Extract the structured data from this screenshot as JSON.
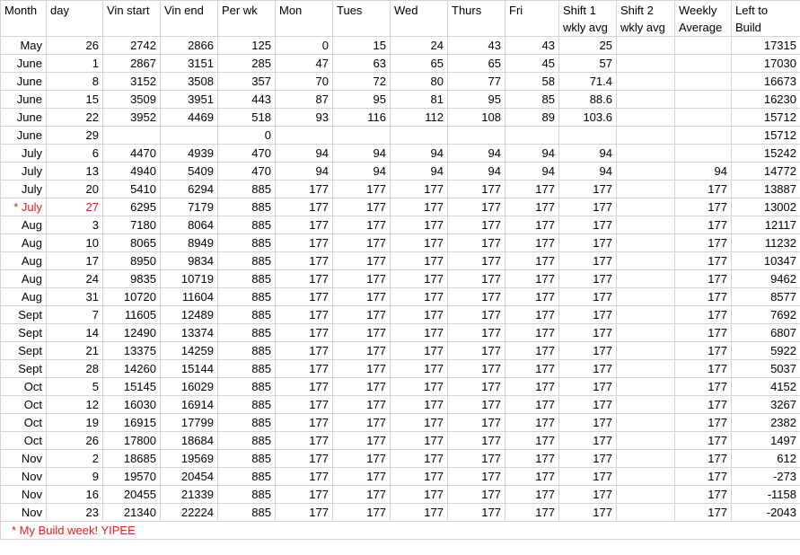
{
  "columns": [
    "Month",
    "day",
    "Vin start",
    "Vin end",
    "Per wk",
    "Mon",
    "Tues",
    "Wed",
    "Thurs",
    "Fri",
    "Shift 1 wkly avg",
    "Shift 2 wkly avg",
    "Weekly Average",
    "Left to Build"
  ],
  "rows": [
    {
      "month": "May",
      "day": "26",
      "vin_start": "2742",
      "vin_end": "2866",
      "per_wk": "125",
      "mon": "0",
      "tues": "15",
      "wed": "24",
      "thurs": "43",
      "fri": "43",
      "shift1": "25",
      "shift2": "",
      "weekly_avg": "",
      "left": "17315"
    },
    {
      "month": "June",
      "day": "1",
      "vin_start": "2867",
      "vin_end": "3151",
      "per_wk": "285",
      "mon": "47",
      "tues": "63",
      "wed": "65",
      "thurs": "65",
      "fri": "45",
      "shift1": "57",
      "shift2": "",
      "weekly_avg": "",
      "left": "17030"
    },
    {
      "month": "June",
      "day": "8",
      "vin_start": "3152",
      "vin_end": "3508",
      "per_wk": "357",
      "mon": "70",
      "tues": "72",
      "wed": "80",
      "thurs": "77",
      "fri": "58",
      "shift1": "71.4",
      "shift2": "",
      "weekly_avg": "",
      "left": "16673"
    },
    {
      "month": "June",
      "day": "15",
      "vin_start": "3509",
      "vin_end": "3951",
      "per_wk": "443",
      "mon": "87",
      "tues": "95",
      "wed": "81",
      "thurs": "95",
      "fri": "85",
      "shift1": "88.6",
      "shift2": "",
      "weekly_avg": "",
      "left": "16230"
    },
    {
      "month": "June",
      "day": "22",
      "vin_start": "3952",
      "vin_end": "4469",
      "per_wk": "518",
      "mon": "93",
      "tues": "116",
      "wed": "112",
      "thurs": "108",
      "fri": "89",
      "shift1": "103.6",
      "shift2": "",
      "weekly_avg": "",
      "left": "15712"
    },
    {
      "month": "June",
      "day": "29",
      "vin_start": "",
      "vin_end": "",
      "per_wk": "0",
      "mon": "",
      "tues": "",
      "wed": "",
      "thurs": "",
      "fri": "",
      "shift1": "",
      "shift2": "",
      "weekly_avg": "",
      "left": "15712"
    },
    {
      "month": "July",
      "day": "6",
      "vin_start": "4470",
      "vin_end": "4939",
      "per_wk": "470",
      "mon": "94",
      "tues": "94",
      "wed": "94",
      "thurs": "94",
      "fri": "94",
      "shift1": "94",
      "shift2": "",
      "weekly_avg": "",
      "left": "15242"
    },
    {
      "month": "July",
      "day": "13",
      "vin_start": "4940",
      "vin_end": "5409",
      "per_wk": "470",
      "mon": "94",
      "tues": "94",
      "wed": "94",
      "thurs": "94",
      "fri": "94",
      "shift1": "94",
      "shift2": "",
      "weekly_avg": "94",
      "left": "14772"
    },
    {
      "month": "July",
      "day": "20",
      "vin_start": "5410",
      "vin_end": "6294",
      "per_wk": "885",
      "mon": "177",
      "tues": "177",
      "wed": "177",
      "thurs": "177",
      "fri": "177",
      "shift1": "177",
      "shift2": "",
      "weekly_avg": "177",
      "left": "13887"
    },
    {
      "month": "* July",
      "day": "27",
      "vin_start": "6295",
      "vin_end": "7179",
      "per_wk": "885",
      "mon": "177",
      "tues": "177",
      "wed": "177",
      "thurs": "177",
      "fri": "177",
      "shift1": "177",
      "shift2": "",
      "weekly_avg": "177",
      "left": "13002",
      "highlight": true
    },
    {
      "month": "Aug",
      "day": "3",
      "vin_start": "7180",
      "vin_end": "8064",
      "per_wk": "885",
      "mon": "177",
      "tues": "177",
      "wed": "177",
      "thurs": "177",
      "fri": "177",
      "shift1": "177",
      "shift2": "",
      "weekly_avg": "177",
      "left": "12117"
    },
    {
      "month": "Aug",
      "day": "10",
      "vin_start": "8065",
      "vin_end": "8949",
      "per_wk": "885",
      "mon": "177",
      "tues": "177",
      "wed": "177",
      "thurs": "177",
      "fri": "177",
      "shift1": "177",
      "shift2": "",
      "weekly_avg": "177",
      "left": "11232"
    },
    {
      "month": "Aug",
      "day": "17",
      "vin_start": "8950",
      "vin_end": "9834",
      "per_wk": "885",
      "mon": "177",
      "tues": "177",
      "wed": "177",
      "thurs": "177",
      "fri": "177",
      "shift1": "177",
      "shift2": "",
      "weekly_avg": "177",
      "left": "10347"
    },
    {
      "month": "Aug",
      "day": "24",
      "vin_start": "9835",
      "vin_end": "10719",
      "per_wk": "885",
      "mon": "177",
      "tues": "177",
      "wed": "177",
      "thurs": "177",
      "fri": "177",
      "shift1": "177",
      "shift2": "",
      "weekly_avg": "177",
      "left": "9462"
    },
    {
      "month": "Aug",
      "day": "31",
      "vin_start": "10720",
      "vin_end": "11604",
      "per_wk": "885",
      "mon": "177",
      "tues": "177",
      "wed": "177",
      "thurs": "177",
      "fri": "177",
      "shift1": "177",
      "shift2": "",
      "weekly_avg": "177",
      "left": "8577"
    },
    {
      "month": "Sept",
      "day": "7",
      "vin_start": "11605",
      "vin_end": "12489",
      "per_wk": "885",
      "mon": "177",
      "tues": "177",
      "wed": "177",
      "thurs": "177",
      "fri": "177",
      "shift1": "177",
      "shift2": "",
      "weekly_avg": "177",
      "left": "7692"
    },
    {
      "month": "Sept",
      "day": "14",
      "vin_start": "12490",
      "vin_end": "13374",
      "per_wk": "885",
      "mon": "177",
      "tues": "177",
      "wed": "177",
      "thurs": "177",
      "fri": "177",
      "shift1": "177",
      "shift2": "",
      "weekly_avg": "177",
      "left": "6807"
    },
    {
      "month": "Sept",
      "day": "21",
      "vin_start": "13375",
      "vin_end": "14259",
      "per_wk": "885",
      "mon": "177",
      "tues": "177",
      "wed": "177",
      "thurs": "177",
      "fri": "177",
      "shift1": "177",
      "shift2": "",
      "weekly_avg": "177",
      "left": "5922"
    },
    {
      "month": "Sept",
      "day": "28",
      "vin_start": "14260",
      "vin_end": "15144",
      "per_wk": "885",
      "mon": "177",
      "tues": "177",
      "wed": "177",
      "thurs": "177",
      "fri": "177",
      "shift1": "177",
      "shift2": "",
      "weekly_avg": "177",
      "left": "5037"
    },
    {
      "month": "Oct",
      "day": "5",
      "vin_start": "15145",
      "vin_end": "16029",
      "per_wk": "885",
      "mon": "177",
      "tues": "177",
      "wed": "177",
      "thurs": "177",
      "fri": "177",
      "shift1": "177",
      "shift2": "",
      "weekly_avg": "177",
      "left": "4152"
    },
    {
      "month": "Oct",
      "day": "12",
      "vin_start": "16030",
      "vin_end": "16914",
      "per_wk": "885",
      "mon": "177",
      "tues": "177",
      "wed": "177",
      "thurs": "177",
      "fri": "177",
      "shift1": "177",
      "shift2": "",
      "weekly_avg": "177",
      "left": "3267"
    },
    {
      "month": "Oct",
      "day": "19",
      "vin_start": "16915",
      "vin_end": "17799",
      "per_wk": "885",
      "mon": "177",
      "tues": "177",
      "wed": "177",
      "thurs": "177",
      "fri": "177",
      "shift1": "177",
      "shift2": "",
      "weekly_avg": "177",
      "left": "2382"
    },
    {
      "month": "Oct",
      "day": "26",
      "vin_start": "17800",
      "vin_end": "18684",
      "per_wk": "885",
      "mon": "177",
      "tues": "177",
      "wed": "177",
      "thurs": "177",
      "fri": "177",
      "shift1": "177",
      "shift2": "",
      "weekly_avg": "177",
      "left": "1497"
    },
    {
      "month": "Nov",
      "day": "2",
      "vin_start": "18685",
      "vin_end": "19569",
      "per_wk": "885",
      "mon": "177",
      "tues": "177",
      "wed": "177",
      "thurs": "177",
      "fri": "177",
      "shift1": "177",
      "shift2": "",
      "weekly_avg": "177",
      "left": "612"
    },
    {
      "month": "Nov",
      "day": "9",
      "vin_start": "19570",
      "vin_end": "20454",
      "per_wk": "885",
      "mon": "177",
      "tues": "177",
      "wed": "177",
      "thurs": "177",
      "fri": "177",
      "shift1": "177",
      "shift2": "",
      "weekly_avg": "177",
      "left": "-273"
    },
    {
      "month": "Nov",
      "day": "16",
      "vin_start": "20455",
      "vin_end": "21339",
      "per_wk": "885",
      "mon": "177",
      "tues": "177",
      "wed": "177",
      "thurs": "177",
      "fri": "177",
      "shift1": "177",
      "shift2": "",
      "weekly_avg": "177",
      "left": "-1158"
    },
    {
      "month": "Nov",
      "day": "23",
      "vin_start": "21340",
      "vin_end": "22224",
      "per_wk": "885",
      "mon": "177",
      "tues": "177",
      "wed": "177",
      "thurs": "177",
      "fri": "177",
      "shift1": "177",
      "shift2": "",
      "weekly_avg": "177",
      "left": "-2043"
    }
  ],
  "footnote": "* My Build week! YIPEE",
  "colors": {
    "gridline": "#d4d4d4",
    "highlight_text": "#e02020",
    "text": "#000000",
    "background": "#ffffff"
  }
}
